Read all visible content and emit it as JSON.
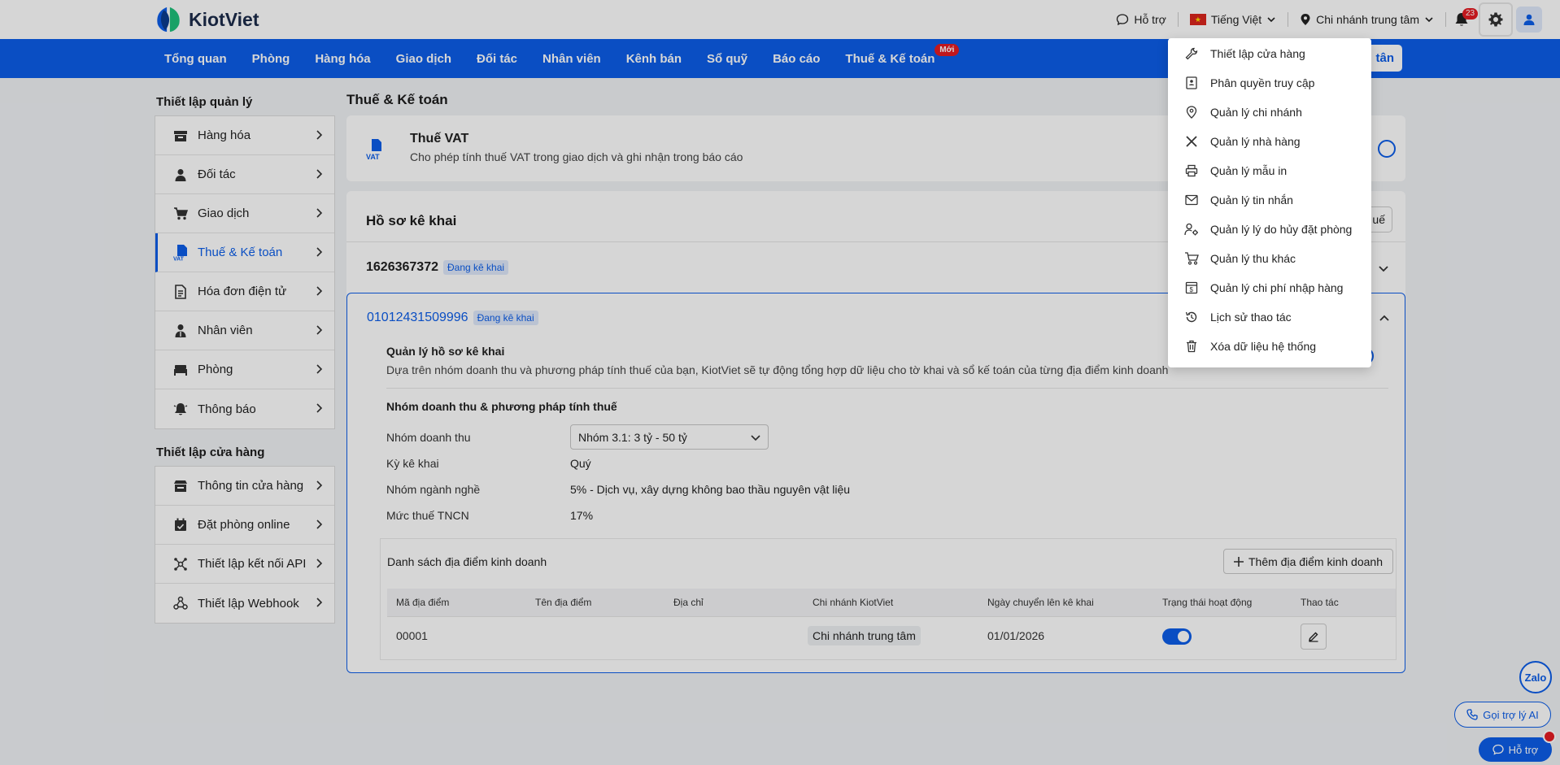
{
  "brand": {
    "name": "KiotViet"
  },
  "topbar": {
    "support": "Hỗ trợ",
    "language": "Tiếng Việt",
    "branch": "Chi nhánh trung tâm",
    "notif_count": "23"
  },
  "nav": {
    "items": [
      "Tổng quan",
      "Phòng",
      "Hàng hóa",
      "Giao dịch",
      "Đối tác",
      "Nhân viên",
      "Kênh bán",
      "Sổ quỹ",
      "Báo cáo",
      "Thuế & Kế toán"
    ],
    "new_badge": "Mới",
    "right_button": "tân"
  },
  "sidebar": {
    "section1_title": "Thiết lập quản lý",
    "section1": [
      {
        "label": "Hàng hóa",
        "icon": "box-icon"
      },
      {
        "label": "Đối tác",
        "icon": "person-icon"
      },
      {
        "label": "Giao dịch",
        "icon": "cart-icon"
      },
      {
        "label": "Thuế & Kế toán",
        "icon": "vat-icon"
      },
      {
        "label": "Hóa đơn điện tử",
        "icon": "invoice-icon"
      },
      {
        "label": "Nhân viên",
        "icon": "staff-icon"
      },
      {
        "label": "Phòng",
        "icon": "bed-icon"
      },
      {
        "label": "Thông báo",
        "icon": "bell-icon"
      }
    ],
    "section2_title": "Thiết lập cửa hàng",
    "section2": [
      {
        "label": "Thông tin cửa hàng",
        "icon": "store-icon"
      },
      {
        "label": "Đặt phòng online",
        "icon": "calendar-icon"
      },
      {
        "label": "Thiết lập kết nối API",
        "icon": "api-icon"
      },
      {
        "label": "Thiết lập Webhook",
        "icon": "webhook-icon"
      }
    ]
  },
  "main": {
    "page_title": "Thuế & Kế toán",
    "vat": {
      "icon_text": "VAT",
      "title": "Thuế VAT",
      "subtitle": "Cho phép tính thuế VAT trong giao dịch và ghi nhận trong báo cáo"
    },
    "ho_so": {
      "title": "Hồ sơ kê khai",
      "button": "uế",
      "row1": {
        "id": "1626367372",
        "tag": "Đang kê khai"
      },
      "row2": {
        "id": "01012431509996",
        "tag": "Đang kê khai"
      },
      "manage_title": "Quản lý hồ sơ kê khai",
      "manage_sub": "Dựa trên nhóm doanh thu và phương pháp tính thuế của bạn, KiotViet sẽ tự động tổng hợp dữ liệu cho tờ khai và sổ kế toán của từng địa điểm kinh doanh",
      "group_title": "Nhóm doanh thu & phương pháp tính thuế",
      "fields": {
        "revenue_group_label": "Nhóm doanh thu",
        "revenue_group_value": "Nhóm 3.1: 3 tỷ - 50 tỷ",
        "period_label": "Kỳ kê khai",
        "period_value": "Quý",
        "industry_label": "Nhóm ngành nghề",
        "industry_value": "5% - Dịch vụ, xây dựng không bao thầu nguyên vật liệu",
        "tax_label": "Mức thuế TNCN",
        "tax_value": "17%"
      },
      "locations": {
        "title": "Danh sách địa điểm kinh doanh",
        "add_button": "Thêm địa điểm kinh doanh",
        "columns": [
          "Mã địa điểm",
          "Tên địa điểm",
          "Địa chỉ",
          "Chi nhánh KiotViet",
          "Ngày chuyển lên kê khai",
          "Trạng thái hoạt động",
          "Thao tác"
        ],
        "rows": [
          {
            "code": "00001",
            "name": "",
            "address": "",
            "branch": "Chi nhánh trung tâm",
            "date": "01/01/2026",
            "active": true
          }
        ]
      }
    }
  },
  "settings_menu": {
    "items": [
      "Thiết lập cửa hàng",
      "Phân quyền truy cập",
      "Quản lý chi nhánh",
      "Quản lý nhà hàng",
      "Quản lý mẫu in",
      "Quản lý tin nhắn",
      "Quản lý lý do hủy đặt phòng",
      "Quản lý thu khác",
      "Quản lý chi phí nhập hàng",
      "Lịch sử thao tác",
      "Xóa dữ liệu hệ thống"
    ]
  },
  "floating": {
    "zalo": "Zalo",
    "ai": "Gọi trợ lý AI",
    "help": "Hỗ trợ"
  },
  "colors": {
    "primary": "#0c5ee9",
    "danger": "#e51c23"
  }
}
